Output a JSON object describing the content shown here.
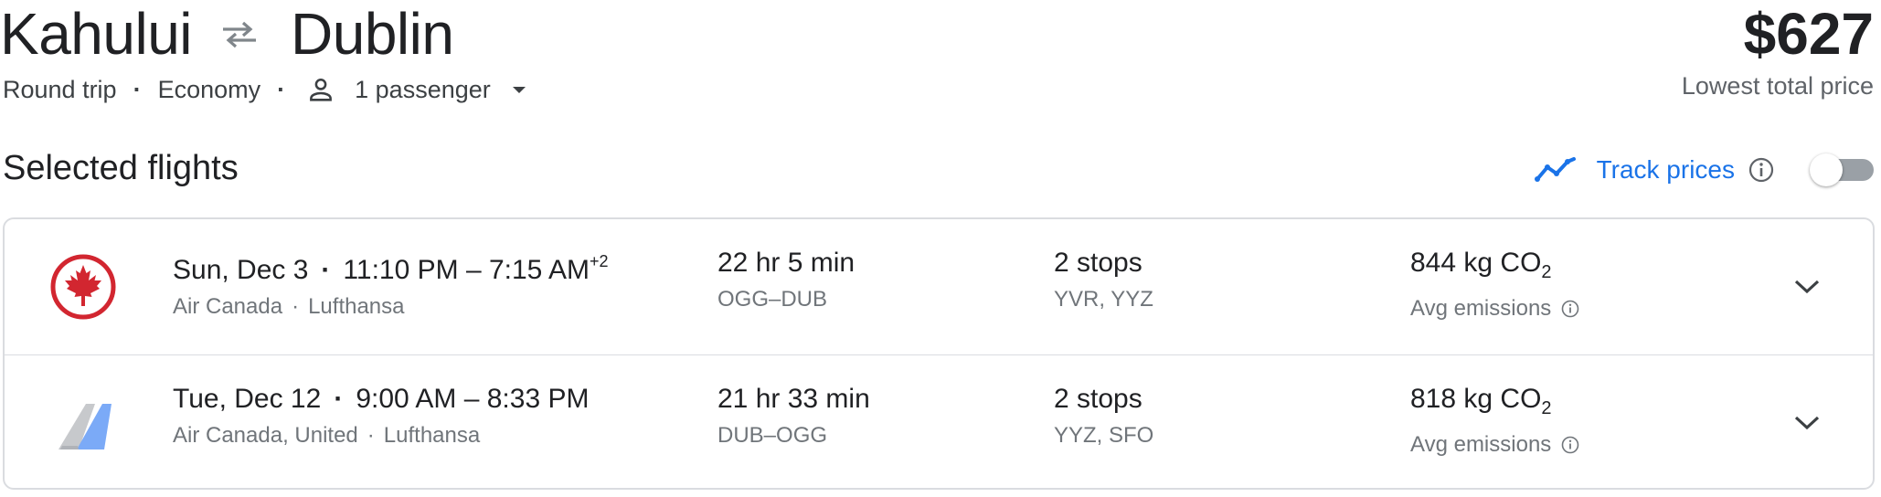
{
  "header": {
    "origin": "Kahului",
    "destination": "Dublin",
    "swap_icon": "swap-arrows-icon",
    "trip_type": "Round trip",
    "cabin_class": "Economy",
    "passengers": "1 passenger",
    "passenger_icon": "person-icon",
    "price": "$627",
    "price_label": "Lowest total price"
  },
  "section": {
    "title": "Selected flights",
    "track_label": "Track prices",
    "track_enabled": false,
    "accent_color": "#1a73e8"
  },
  "flights": [
    {
      "logo": "air-canada-maple-leaf-icon",
      "date": "Sun, Dec 3",
      "depart": "11:10 PM",
      "arrive": "7:15 AM",
      "plus_days": "+2",
      "airlines": "Air Canada",
      "operator": "Lufthansa",
      "duration": "22 hr 5 min",
      "route": "OGG–DUB",
      "stops": "2 stops",
      "stop_airports": "YVR, YYZ",
      "emissions_value": "844 kg CO",
      "emissions_sub": "2",
      "emissions_label": "Avg emissions"
    },
    {
      "logo": "multi-airline-tail-icon",
      "date": "Tue, Dec 12",
      "depart": "9:00 AM",
      "arrive": "8:33 PM",
      "plus_days": "",
      "airlines": "Air Canada, United",
      "operator": "Lufthansa",
      "duration": "21 hr 33 min",
      "route": "DUB–OGG",
      "stops": "2 stops",
      "stop_airports": "YYZ, SFO",
      "emissions_value": "818 kg CO",
      "emissions_sub": "2",
      "emissions_label": "Avg emissions"
    }
  ]
}
